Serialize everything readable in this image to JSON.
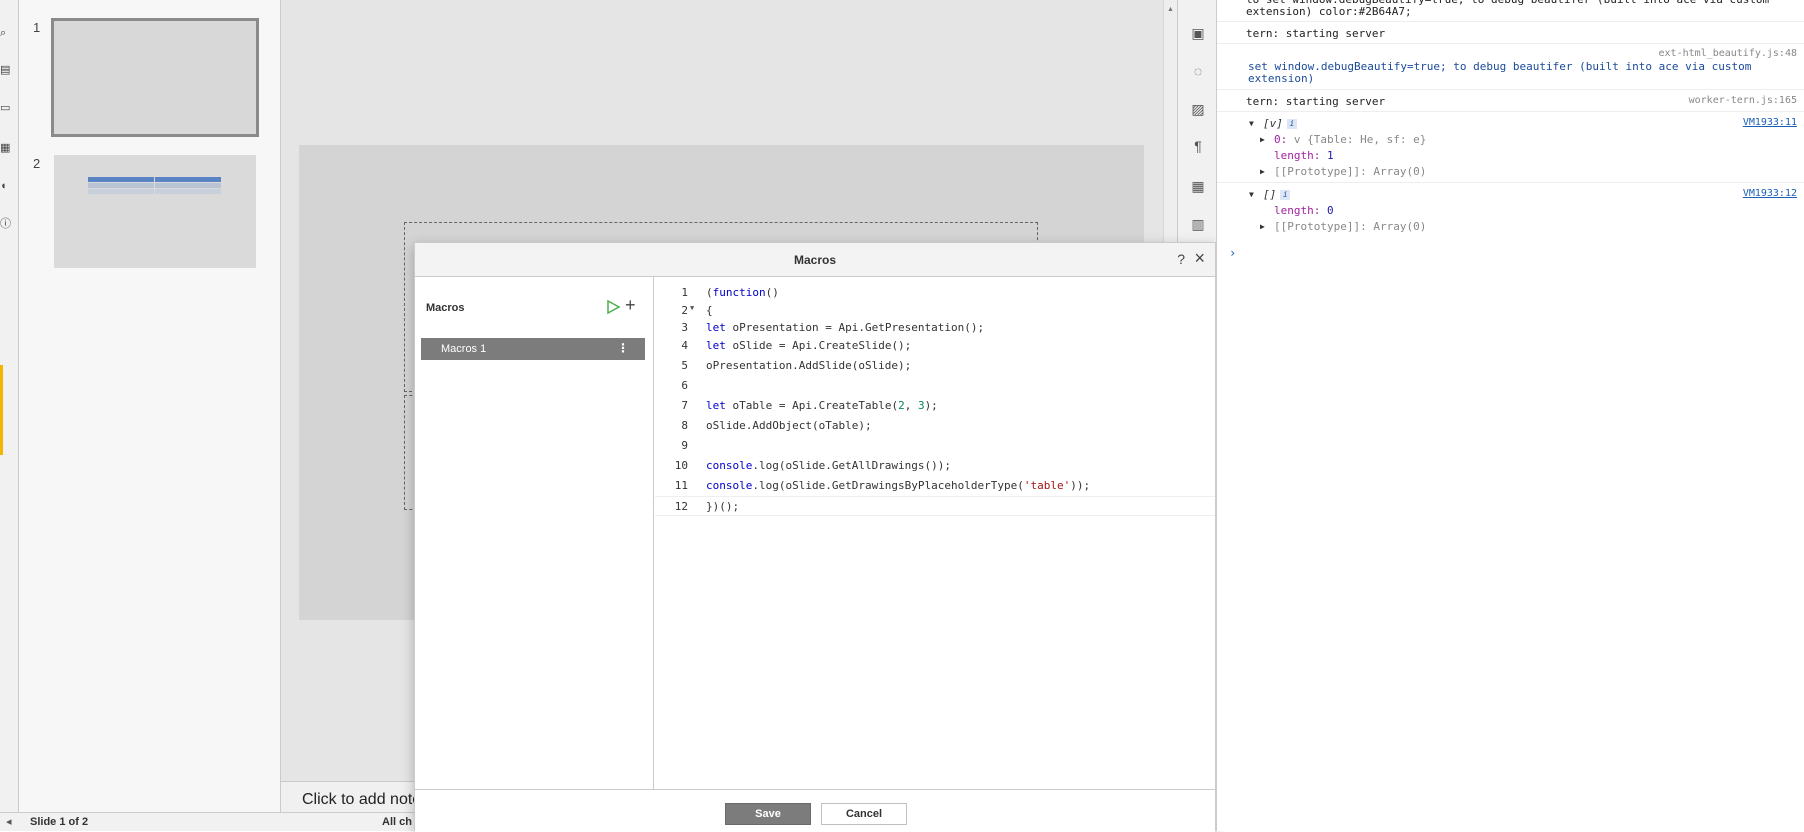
{
  "slides": {
    "thumbnails": [
      {
        "number": "1"
      },
      {
        "number": "2"
      }
    ]
  },
  "notes_placeholder": "Click to add note",
  "status_bar": {
    "slide_counter": "Slide 1 of 2",
    "changes_text": "All ch"
  },
  "dialog": {
    "title": "Macros",
    "help_label": "?",
    "close_label": "×",
    "pane_title": "Macros",
    "add_label": "+",
    "macro_items": [
      {
        "label": "Macros 1",
        "menu": "⋮"
      }
    ],
    "code_lines": [
      {
        "n": "1",
        "text": "(function()"
      },
      {
        "n": "2",
        "text": "{"
      },
      {
        "n": "3",
        "text": "let oPresentation = Api.GetPresentation();"
      },
      {
        "n": "4",
        "text": "let oSlide = Api.CreateSlide();"
      },
      {
        "n": "5",
        "text": "oPresentation.AddSlide(oSlide);"
      },
      {
        "n": "6",
        "text": ""
      },
      {
        "n": "7",
        "text": "let oTable = Api.CreateTable(2, 3);"
      },
      {
        "n": "8",
        "text": "oSlide.AddObject(oTable);"
      },
      {
        "n": "9",
        "text": ""
      },
      {
        "n": "10",
        "text": "console.log(oSlide.GetAllDrawings());"
      },
      {
        "n": "11",
        "text": "console.log(oSlide.GetDrawingsByPlaceholderType('table'));"
      },
      {
        "n": "12",
        "text": "})();"
      }
    ],
    "save_label": "Save",
    "cancel_label": "Cancel"
  },
  "console": {
    "messages": [
      {
        "text": "to set window.debugBeautify=true; to debug beautifer (built into ace via custom\nextension) color:#2B64A7;"
      },
      {
        "text": "tern: starting server"
      },
      {
        "source": "ext-html_beautify.js:48",
        "text": "set window.debugBeautify=true; to debug beautifer (built into ace via custom\nextension)"
      },
      {
        "source": "worker-tern.js:165",
        "text": "tern: starting server"
      }
    ],
    "logs": [
      {
        "summary": "[v]",
        "link": "VM1933:11",
        "entry_key": "0",
        "entry_value": "v {Table: He, sf: e}",
        "length_key": "length",
        "length_value": "1",
        "proto": "[[Prototype]]: Array(0)"
      },
      {
        "summary": "[]",
        "link": "VM1933:12",
        "length_key": "length",
        "length_value": "0",
        "proto": "[[Prototype]]: Array(0)"
      }
    ],
    "prompt": "›"
  },
  "colors": {
    "accent_yellow": "#f4b400",
    "table_header_blue": "#5b84c4",
    "table_row_gray": "#b9c3d3",
    "selected_macro_bg": "#7c7c7c",
    "run_icon_green": "#4caf50"
  }
}
